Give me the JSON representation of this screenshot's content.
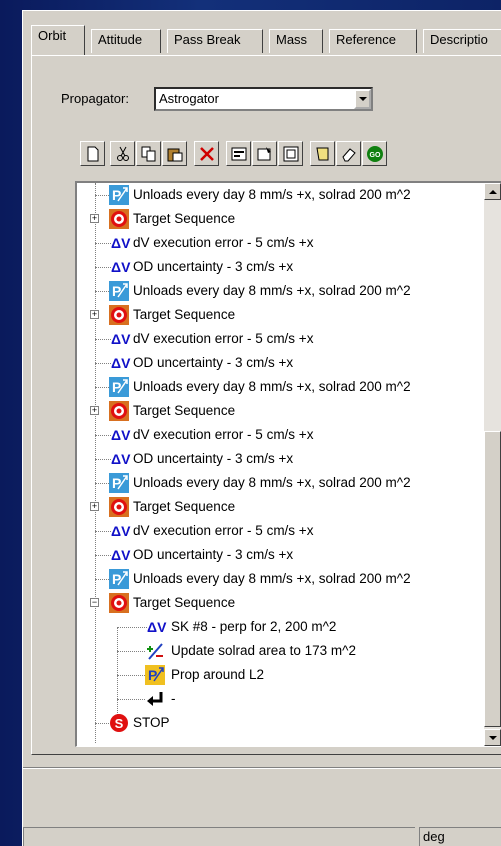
{
  "tabs": [
    {
      "label": "Orbit",
      "active": true
    },
    {
      "label": "Attitude"
    },
    {
      "label": "Pass Break"
    },
    {
      "label": "Mass"
    },
    {
      "label": "Reference"
    },
    {
      "label": "Descriptio"
    }
  ],
  "propagator": {
    "label": "Propagator:",
    "value": "Astrogator"
  },
  "toolbar": [
    {
      "icon": "new-document-icon"
    },
    {
      "icon": "cut-icon"
    },
    {
      "icon": "copy-icon"
    },
    {
      "icon": "paste-icon"
    },
    {
      "icon": "delete-icon"
    },
    {
      "icon": "properties-icon"
    },
    {
      "icon": "component-icon"
    },
    {
      "icon": "view-icon"
    },
    {
      "icon": "summary-icon"
    },
    {
      "icon": "eraser-icon"
    },
    {
      "icon": "go-icon"
    }
  ],
  "tree": {
    "rows": [
      {
        "type": "maneuver-prop",
        "text": "Unloads every day 8 mm/s +x, solrad 200 m^2"
      },
      {
        "type": "target",
        "text": "Target Sequence"
      },
      {
        "type": "dv",
        "icon_text": "ΔV",
        "text": "dV execution error - 5 cm/s +x"
      },
      {
        "type": "dv",
        "icon_text": "ΔV",
        "text": "OD uncertainty - 3 cm/s +x"
      },
      {
        "type": "maneuver-prop",
        "text": "Unloads every day 8 mm/s +x, solrad 200 m^2"
      },
      {
        "type": "target",
        "text": "Target Sequence"
      },
      {
        "type": "dv",
        "icon_text": "ΔV",
        "text": "dV execution error - 5 cm/s +x"
      },
      {
        "type": "dv",
        "icon_text": "ΔV",
        "text": "OD uncertainty - 3 cm/s +x"
      },
      {
        "type": "maneuver-prop",
        "text": "Unloads every day 8 mm/s +x, solrad 200 m^2"
      },
      {
        "type": "target",
        "text": "Target Sequence"
      },
      {
        "type": "dv",
        "icon_text": "ΔV",
        "text": "dV execution error - 5 cm/s +x"
      },
      {
        "type": "dv",
        "icon_text": "ΔV",
        "text": "OD uncertainty - 3 cm/s +x"
      },
      {
        "type": "maneuver-prop",
        "text": "Unloads every day 8 mm/s +x, solrad 200 m^2"
      },
      {
        "type": "target",
        "text": "Target Sequence"
      },
      {
        "type": "dv",
        "icon_text": "ΔV",
        "text": "dV execution error - 5 cm/s +x"
      },
      {
        "type": "dv",
        "icon_text": "ΔV",
        "text": "OD uncertainty - 3 cm/s +x"
      },
      {
        "type": "maneuver-prop",
        "text": "Unloads every day 8 mm/s +x, solrad 200 m^2"
      },
      {
        "type": "target-open",
        "text": "Target Sequence"
      },
      {
        "type": "dv-child",
        "icon_text": "ΔV",
        "text": "SK #8 - perp for 2, 200 m^2"
      },
      {
        "type": "update-child",
        "text": "Update solrad area to 173 m^2"
      },
      {
        "type": "prop-child",
        "text": "Prop around L2"
      },
      {
        "type": "return-child",
        "text": "-"
      },
      {
        "type": "stop",
        "text": "STOP"
      }
    ]
  },
  "status_unit": "deg",
  "colors": {
    "panel": "#d4d0c8",
    "background": "#0d2366",
    "dv": "#1010c8",
    "target": "#e01010",
    "stop": "#e01010"
  }
}
